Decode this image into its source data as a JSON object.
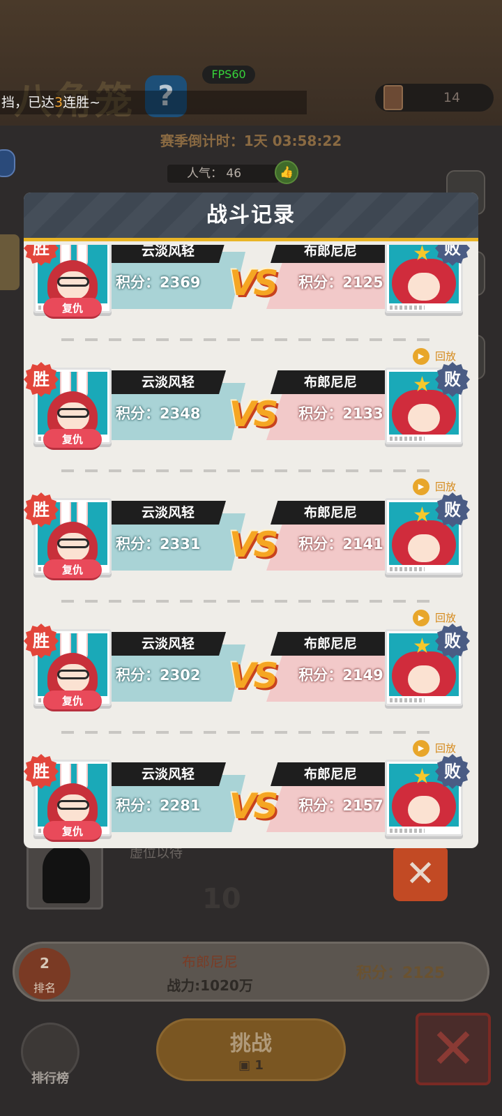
{
  "game_title": "八角笼",
  "help_icon": "question-icon",
  "fps": "FPS60",
  "marquee": {
    "before": "挡，已达",
    "highlight": "3",
    "after": "连胜~"
  },
  "tickets": {
    "icon": "ticket-icon",
    "count": "14"
  },
  "season_timer": "赛季倒计时：1天 03:58:22",
  "popularity": {
    "label": "人气：",
    "value": "46"
  },
  "modal": {
    "title": "战斗记录",
    "revenge_label": "复仇",
    "replay_label": "回放",
    "win_label": "胜",
    "lose_label": "败",
    "vs_label": "VS",
    "records": [
      {
        "left_name": "云淡风轻",
        "left_score": "积分：2369",
        "right_name": "布郎尼尼",
        "right_score": "积分：2125",
        "show_replay": false
      },
      {
        "left_name": "云淡风轻",
        "left_score": "积分：2348",
        "right_name": "布郎尼尼",
        "right_score": "积分：2133",
        "show_replay": true
      },
      {
        "left_name": "云淡风轻",
        "left_score": "积分：2331",
        "right_name": "布郎尼尼",
        "right_score": "积分：2141",
        "show_replay": true
      },
      {
        "left_name": "云淡风轻",
        "left_score": "积分：2302",
        "right_name": "布郎尼尼",
        "right_score": "积分：2149",
        "show_replay": true
      },
      {
        "left_name": "云淡风轻",
        "left_score": "积分：2281",
        "right_name": "布郎尼尼",
        "right_score": "积分：2157",
        "show_replay": true
      }
    ]
  },
  "background_slot": {
    "name": "虚位以待",
    "number": "10"
  },
  "rank_bar": {
    "rank": "2",
    "rank_label": "排名",
    "name": "布郎尼尼",
    "power": "战力:1020万",
    "score": "积分：2125"
  },
  "bottom_nav": {
    "leaderboard_label": "排行榜",
    "challenge_label": "挑战",
    "challenge_cost": "1"
  },
  "colors": {
    "header_accent": "#e9b525",
    "win_badge": "#e2453a",
    "lose_badge": "#4a5c84",
    "revenge_button": "#e94a5a",
    "replay": "#d58a1c"
  }
}
